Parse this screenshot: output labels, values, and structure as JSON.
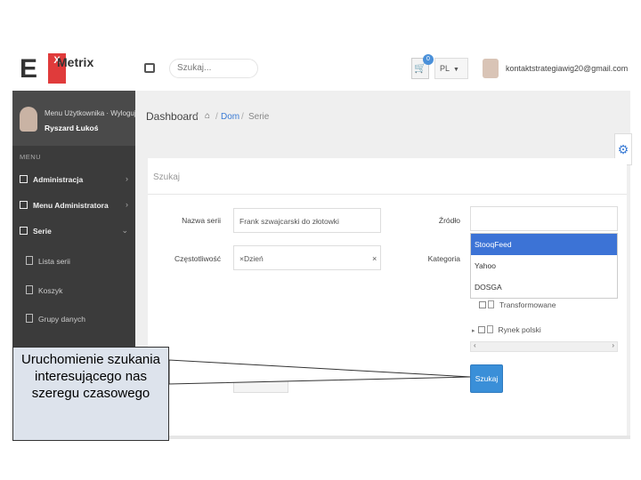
{
  "app": {
    "logo_letter": "E",
    "logo_badge": "X",
    "name": "Metrix"
  },
  "topbar": {
    "search_placeholder": "Szukaj...",
    "cart_icon": "cart-icon",
    "cart_count": "0",
    "language": "PL",
    "user_email": "kontaktstrategiawig20@gmail.com"
  },
  "sidebar": {
    "profile_links": "Menu Użytkownika · Wyloguj",
    "profile_name": "Ryszard Łukoś",
    "menu_header": "MENU",
    "items": [
      {
        "label": "Administracja",
        "chevron": "›"
      },
      {
        "label": "Menu Administratora",
        "chevron": "›"
      },
      {
        "label": "Serie",
        "chevron": "⌄"
      }
    ],
    "subitems": [
      {
        "label": "Lista serii"
      },
      {
        "label": "Koszyk"
      },
      {
        "label": "Grupy danych"
      }
    ]
  },
  "breadcrumb": {
    "title": "Dashboard",
    "home_icon": "⌂",
    "link": "Dom",
    "current": "Serie"
  },
  "panel": {
    "title": "Szukaj",
    "fields": {
      "series_name_label": "Nazwa serii",
      "series_name_value": "Frank szwajcarski do złotowki",
      "frequency_label": "Częstotliwość",
      "frequency_tag": "×Dzień",
      "frequency_clear": "×",
      "source_label": "Źródło",
      "category_label": "Kategoria"
    },
    "source_options": [
      {
        "label": "StooqFeed",
        "selected": true
      },
      {
        "label": "Yahoo",
        "selected": false
      },
      {
        "label": "DOSGA",
        "selected": false
      }
    ],
    "tree": [
      {
        "label": "Transformowane"
      },
      {
        "label": "Rynek polski"
      }
    ],
    "scroll_left": "‹",
    "scroll_right": "›",
    "search_button": "Szukaj"
  },
  "callout": {
    "text": "Uruchomienie szukania interesującego nas szeregu czasowego"
  },
  "colors": {
    "accent": "#3a8fd8",
    "sidebar": "#3b3b3b",
    "logo_red": "#e03b3b",
    "selected_option": "#3c73d6"
  }
}
